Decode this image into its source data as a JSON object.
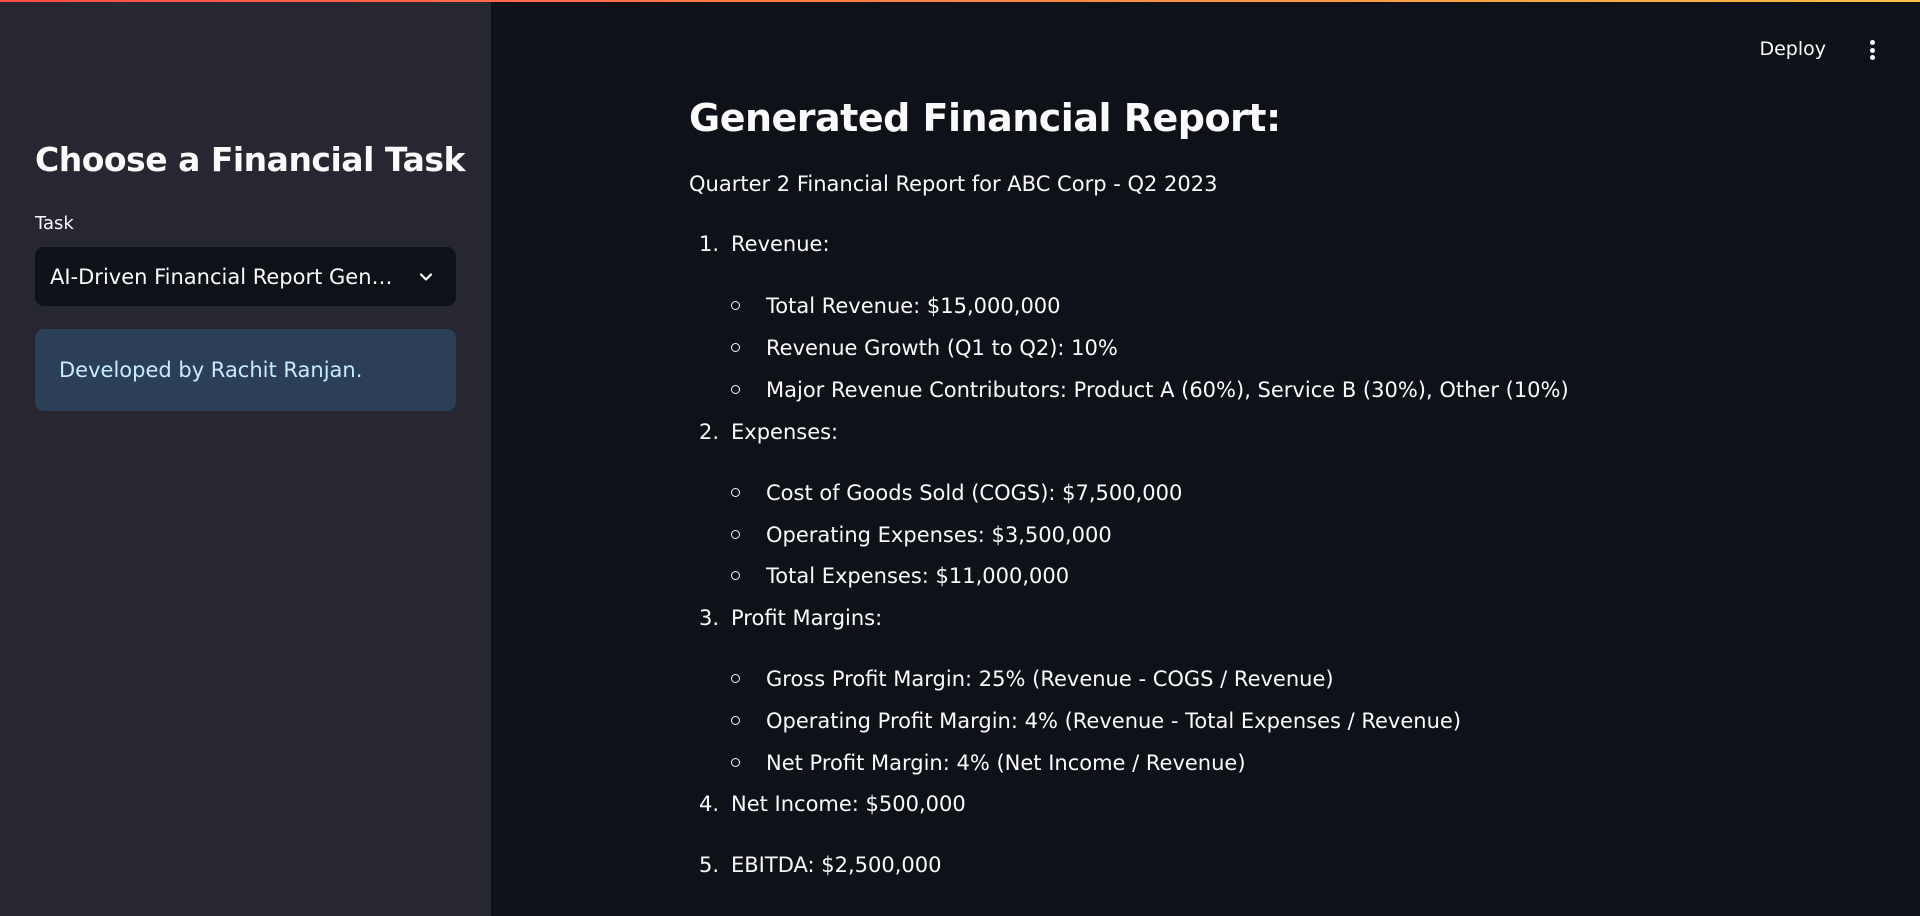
{
  "sidebar": {
    "title": "Choose a Financial Task",
    "task_label": "Task",
    "selected_task": "AI-Driven Financial Report Generation",
    "info": "Developed by Rachit Ranjan."
  },
  "header": {
    "deploy_label": "Deploy"
  },
  "report": {
    "title": "Generated Financial Report:",
    "subtitle": "Quarter 2 Financial Report for ABC Corp - Q2 2023",
    "sections": [
      {
        "num": "1.",
        "label": "Revenue:",
        "items": [
          "Total Revenue: $15,000,000",
          "Revenue Growth (Q1 to Q2): 10%",
          "Major Revenue Contributors: Product A (60%), Service B (30%), Other (10%)"
        ]
      },
      {
        "num": "2.",
        "label": "Expenses:",
        "items": [
          "Cost of Goods Sold (COGS): $7,500,000",
          "Operating Expenses: $3,500,000",
          "Total Expenses: $11,000,000"
        ]
      },
      {
        "num": "3.",
        "label": "Profit Margins:",
        "items": [
          "Gross Profit Margin: 25% (Revenue - COGS / Revenue)",
          "Operating Profit Margin: 4% (Revenue - Total Expenses / Revenue)",
          "Net Profit Margin: 4% (Net Income / Revenue)"
        ]
      },
      {
        "num": "4.",
        "label": "Net Income: $500,000",
        "items": []
      },
      {
        "num": "5.",
        "label": "EBITDA: $2,500,000",
        "items": []
      }
    ]
  }
}
